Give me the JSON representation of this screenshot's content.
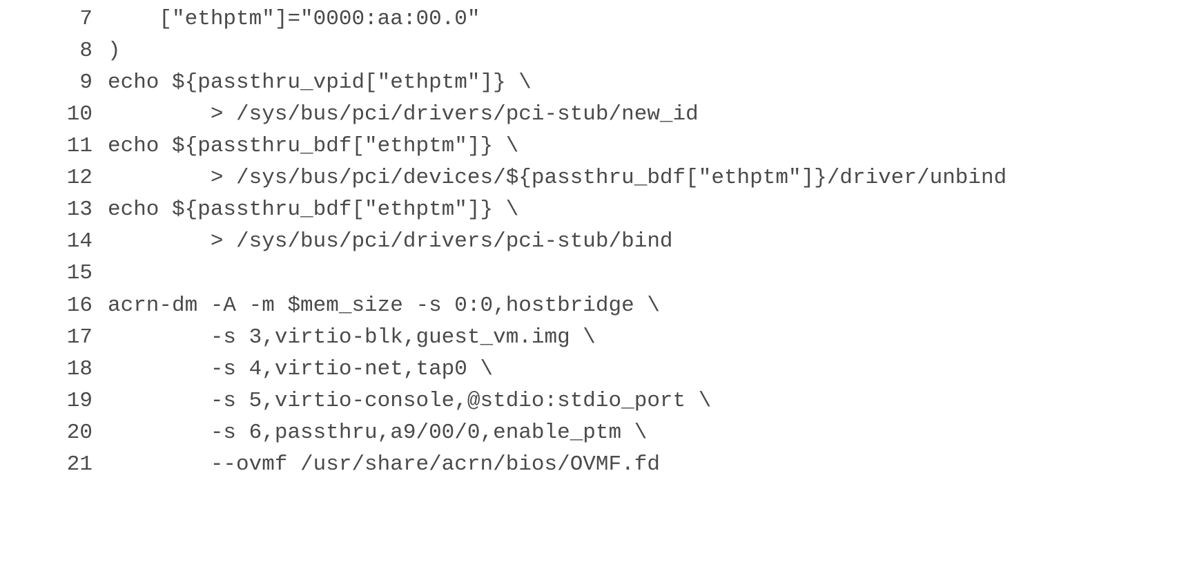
{
  "code": {
    "lines": [
      {
        "number": "7",
        "text": "    [\"ethptm\"]=\"0000:aa:00.0\""
      },
      {
        "number": "8",
        "text": ")"
      },
      {
        "number": "9",
        "text": "echo ${passthru_vpid[\"ethptm\"]} \\"
      },
      {
        "number": "10",
        "text": "        > /sys/bus/pci/drivers/pci-stub/new_id"
      },
      {
        "number": "11",
        "text": "echo ${passthru_bdf[\"ethptm\"]} \\"
      },
      {
        "number": "12",
        "text": "        > /sys/bus/pci/devices/${passthru_bdf[\"ethptm\"]}/driver/unbind"
      },
      {
        "number": "13",
        "text": "echo ${passthru_bdf[\"ethptm\"]} \\"
      },
      {
        "number": "14",
        "text": "        > /sys/bus/pci/drivers/pci-stub/bind"
      },
      {
        "number": "15",
        "text": ""
      },
      {
        "number": "16",
        "text": "acrn-dm -A -m $mem_size -s 0:0,hostbridge \\"
      },
      {
        "number": "17",
        "text": "        -s 3,virtio-blk,guest_vm.img \\"
      },
      {
        "number": "18",
        "text": "        -s 4,virtio-net,tap0 \\"
      },
      {
        "number": "19",
        "text": "        -s 5,virtio-console,@stdio:stdio_port \\"
      },
      {
        "number": "20",
        "text": "        -s 6,passthru,a9/00/0,enable_ptm \\"
      },
      {
        "number": "21",
        "text": "        --ovmf /usr/share/acrn/bios/OVMF.fd"
      }
    ]
  }
}
